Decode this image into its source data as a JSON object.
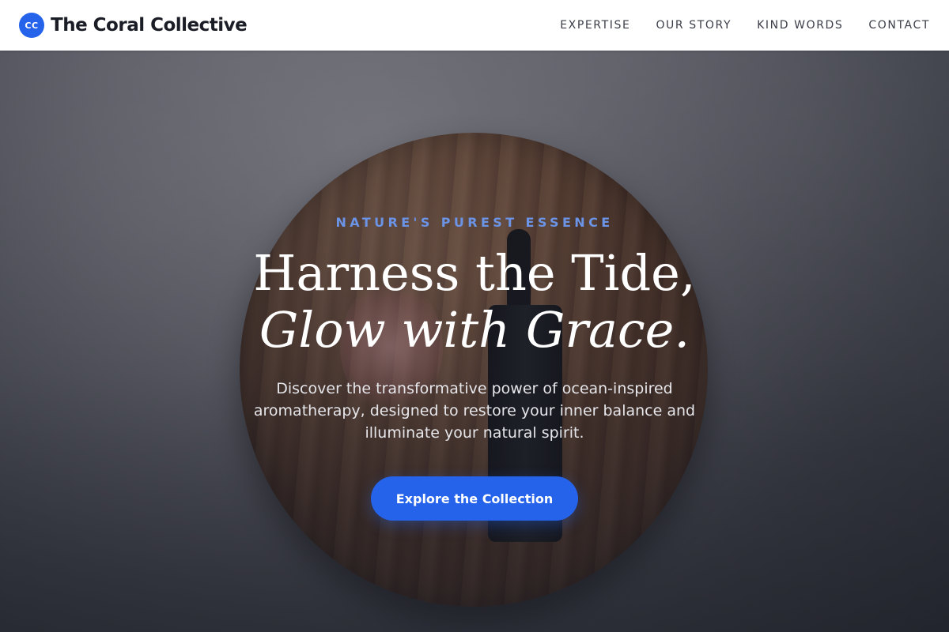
{
  "brand": {
    "logo_text": "CC",
    "name": "The Coral Collective"
  },
  "nav": {
    "items": [
      {
        "label": "EXPERTISE"
      },
      {
        "label": "OUR STORY"
      },
      {
        "label": "KIND WORDS"
      },
      {
        "label": "CONTACT"
      }
    ]
  },
  "hero": {
    "eyebrow": "NATURE'S PUREST ESSENCE",
    "headline_line1": "Harness the Tide,",
    "headline_line2": "Glow with Grace.",
    "subtitle": "Discover the transformative power of ocean-inspired aromatherapy, designed to restore your inner balance and illuminate your natural spirit.",
    "cta_label": "Explore the Collection"
  },
  "colors": {
    "accent": "#2563eb",
    "eyebrow": "#6b93e6",
    "header_bg": "#ffffff"
  }
}
